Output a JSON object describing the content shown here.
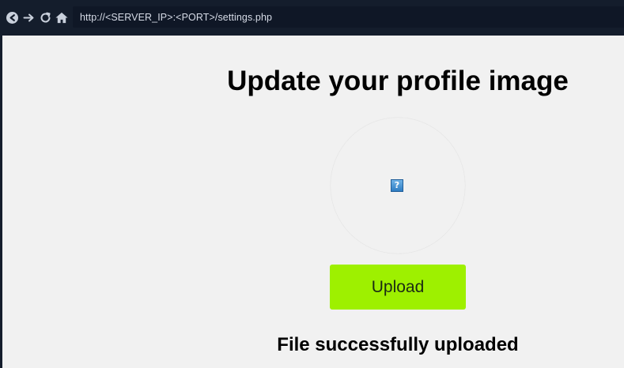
{
  "browser": {
    "url": "http://<SERVER_IP>:<PORT>/settings.php",
    "nav": {
      "back_icon": "back-arrow-icon",
      "forward_icon": "forward-arrow-icon",
      "reload_icon": "reload-icon",
      "home_icon": "home-icon"
    }
  },
  "page": {
    "title": "Update your profile image",
    "avatar": {
      "image_state": "broken-image",
      "broken_glyph": "?"
    },
    "upload_label": "Upload",
    "status_message": "File successfully uploaded"
  },
  "colors": {
    "chrome_bg": "#141d2c",
    "urlbar_bg": "#0f1726",
    "page_bg": "#f1f1f1",
    "upload_button": "#9ef000",
    "text": "#000000"
  }
}
